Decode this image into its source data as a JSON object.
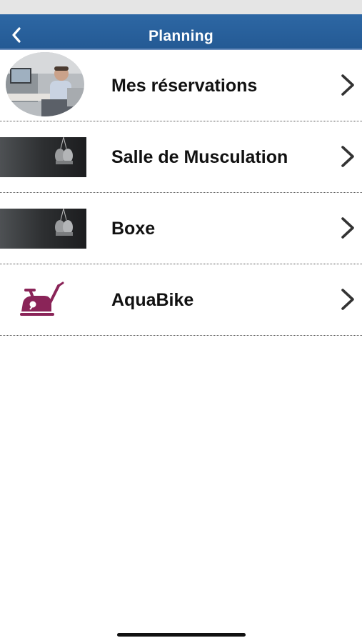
{
  "header": {
    "title": "Planning",
    "back_icon": "chevron-left-icon",
    "background_color": "#2a62a0"
  },
  "menu": {
    "items": [
      {
        "label": "Mes réservations",
        "thumbnail": "office-person-photo"
      },
      {
        "label": "Salle de Musculation",
        "thumbnail": "boxing-gloves-photo"
      },
      {
        "label": "Boxe",
        "thumbnail": "boxing-gloves-photo"
      },
      {
        "label": "AquaBike",
        "thumbnail": "exercise-bike-icon",
        "icon_color": "#8a2458"
      }
    ],
    "chevron_icon": "chevron-right-icon"
  }
}
